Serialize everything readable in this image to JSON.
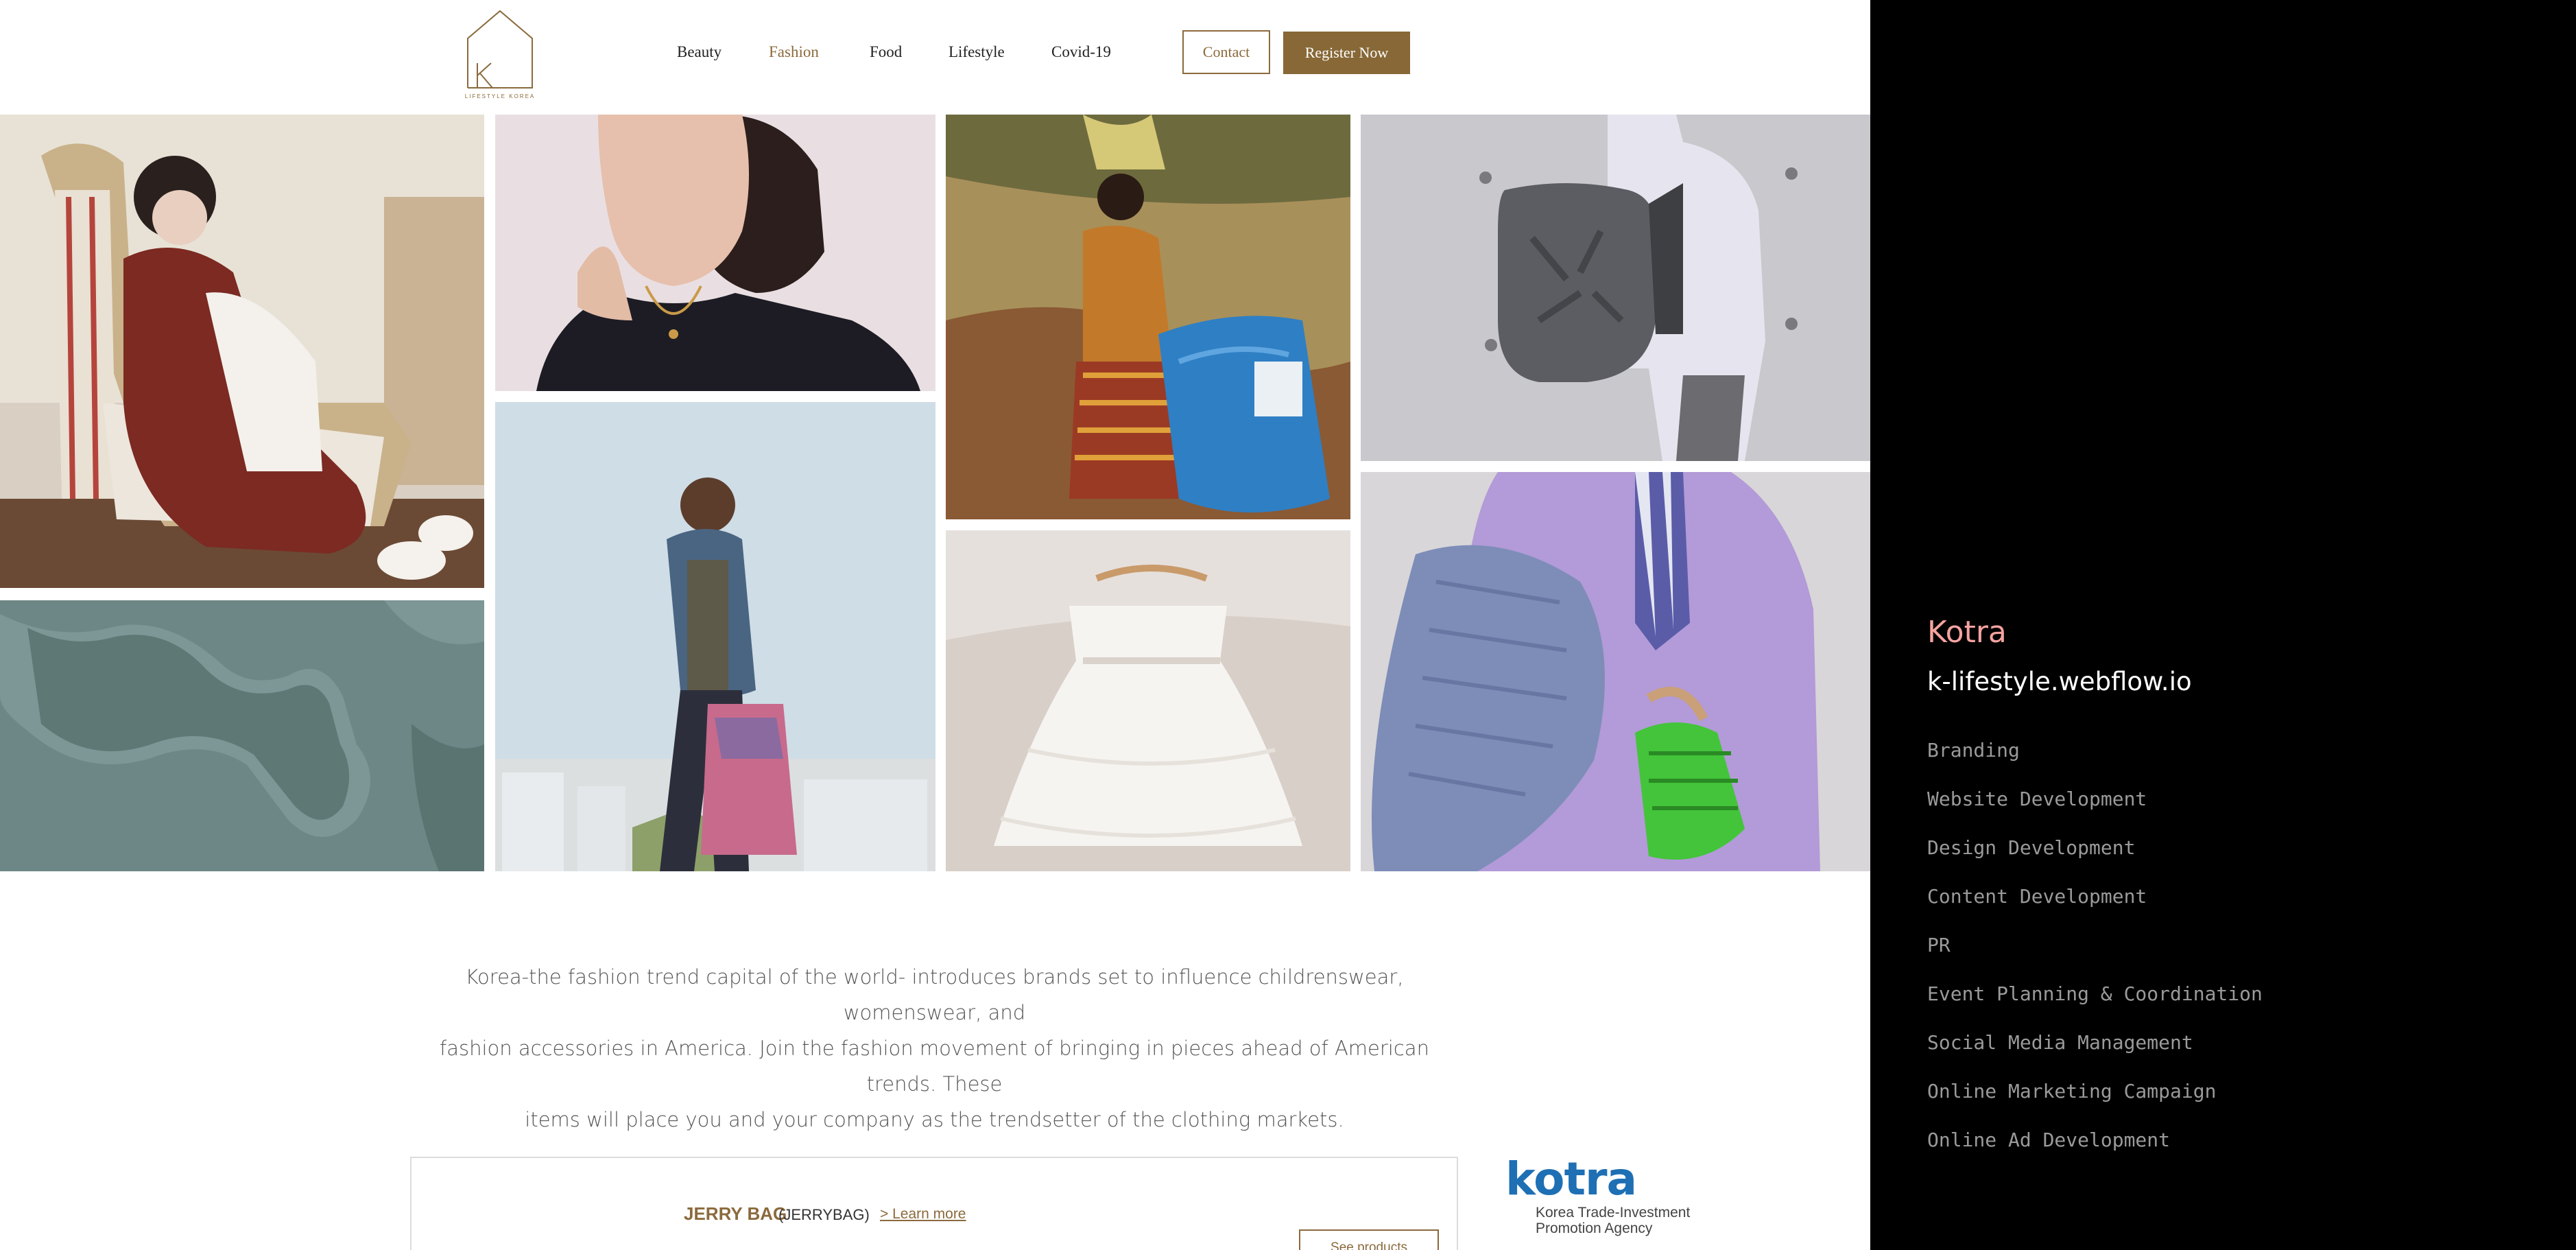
{
  "nav": {
    "logo_text": "LIFESTYLE KOREA",
    "items": [
      {
        "label": "Beauty",
        "active": false
      },
      {
        "label": "Fashion",
        "active": true
      },
      {
        "label": "Food",
        "active": false
      },
      {
        "label": "Lifestyle",
        "active": false
      },
      {
        "label": "Covid-19",
        "active": false
      }
    ],
    "contact_label": "Contact",
    "register_label": "Register Now"
  },
  "gallery": {
    "photos": [
      "girl-on-antique-sofa-photo",
      "woman-with-gold-jewelry-photo",
      "child-carrying-blue-bag-photo",
      "grey-backpack-photo",
      "green-textured-surface-photo",
      "woman-denim-jacket-tote-photo",
      "white-child-dress-on-hanger-photo",
      "lavender-blazer-green-bag-photo"
    ]
  },
  "intro": {
    "line1": "Korea-the fashion trend capital of the world- introduces brands set to influence childrenswear, womenswear, and",
    "line2": "fashion accessories in America. Join the fashion movement of bringing in pieces ahead of American trends. These",
    "line3": "items will place you and your company as the trendsetter of the clothing markets."
  },
  "brand": {
    "name": "JERRY BAG",
    "code": "(JERRYBAG)",
    "learn_more": "> Learn more",
    "see_products": "See products"
  },
  "kotra_logo": {
    "word": "kotra",
    "tagline": "Korea Trade-Investment\nPromotion Agency"
  },
  "panel": {
    "title": "Kotra",
    "url": "k-lifestyle.webflow.io",
    "services": [
      "Branding",
      "Website Development",
      "Design Development",
      "Content Development",
      "PR",
      "Event Planning & Coordination",
      "Social Media Management",
      "Online Marketing Campaign",
      "Online Ad Development"
    ]
  },
  "colors": {
    "brand_gold": "#876836",
    "panel_title": "#f5a3a0",
    "kotra_blue": "#1e6fb4"
  }
}
